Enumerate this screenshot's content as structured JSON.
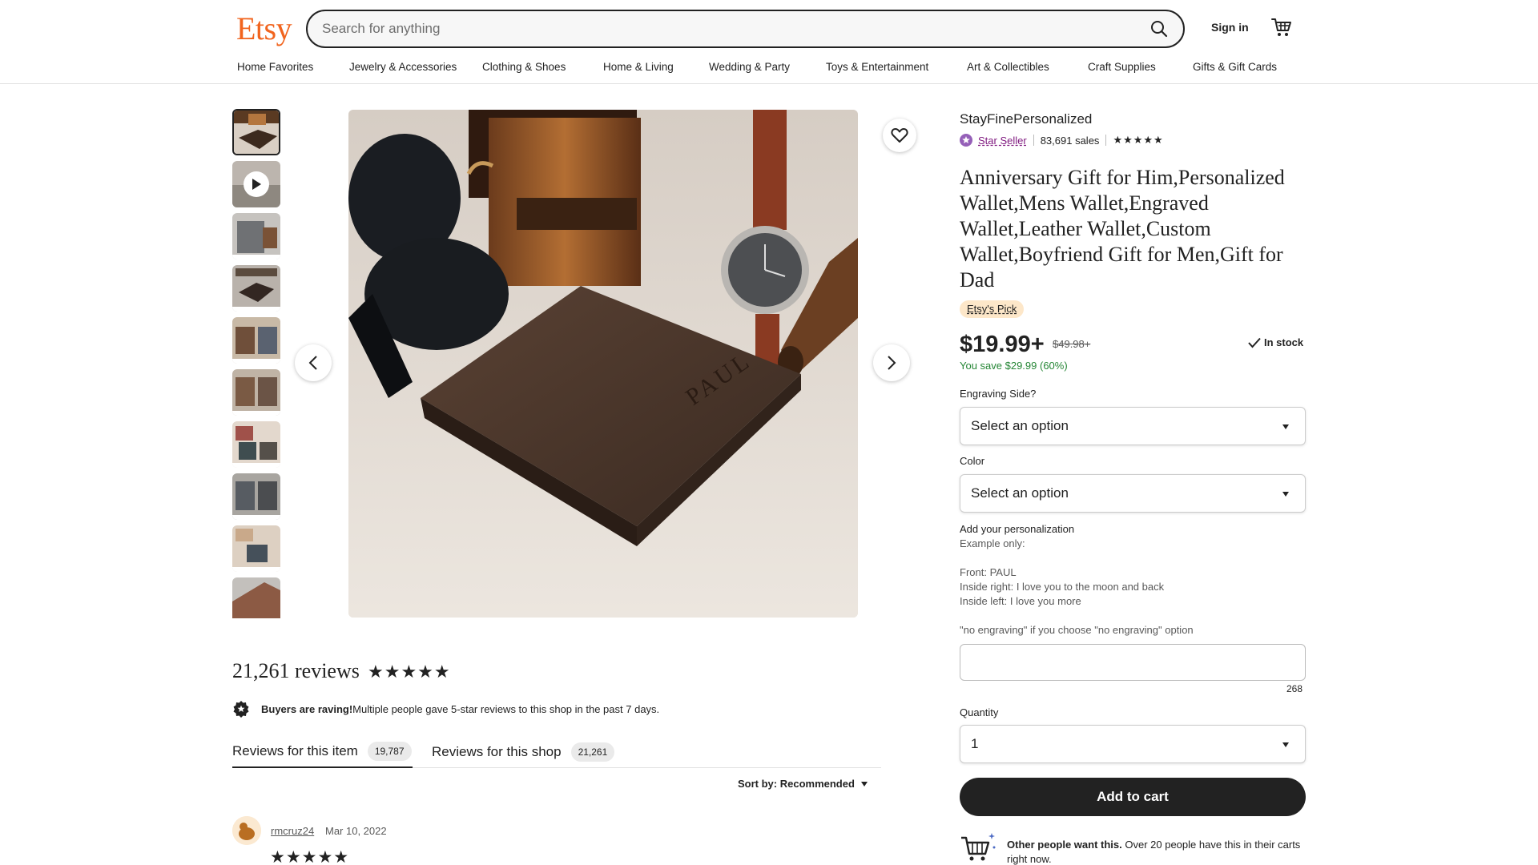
{
  "header": {
    "logo": "Etsy",
    "search_placeholder": "Search for anything",
    "signin_label": "Sign in",
    "categories": [
      "Home Favorites",
      "Jewelry & Accessories",
      "Clothing & Shoes",
      "Home & Living",
      "Wedding & Party",
      "Toys & Entertainment",
      "Art & Collectibles",
      "Craft Supplies",
      "Gifts & Gift Cards"
    ]
  },
  "gallery": {
    "main_image_engraving": "PAUL",
    "thumbnail_count": 10
  },
  "listing": {
    "shop_name": "StayFinePersonalized",
    "star_seller_label": "Star Seller",
    "sales": "83,691 sales",
    "shop_rating_stars": "★★★★★",
    "title": "Anniversary Gift for Him,Personalized Wallet,Mens Wallet,Engraved Wallet,Leather Wallet,Custom Wallet,Boyfriend Gift for Men,Gift for Dad",
    "badge": "Etsy's Pick",
    "price": "$19.99+",
    "original_price": "$49.98+",
    "stock": "In stock",
    "savings": "You save $29.99 (60%)",
    "engraving_side_label": "Engraving Side?",
    "engraving_side_value": "Select an option",
    "color_label": "Color",
    "color_value": "Select an option",
    "personalization_label": "Add your personalization",
    "example_only": "Example only:",
    "example_front": "Front: PAUL",
    "example_inside_right": "Inside right: I love you to the moon and back",
    "example_inside_left": "Inside left: I love you more",
    "no_engraving_note": "\"no engraving\" if you choose \"no engraving\" option",
    "char_counter": "268",
    "quantity_label": "Quantity",
    "quantity_value": "1",
    "add_to_cart": "Add to cart",
    "other_people_bold": "Other people want this.",
    "other_people_text": " Over 20 people have this in their carts right now."
  },
  "reviews": {
    "heading": "21,261 reviews",
    "stars": "★★★★★",
    "raving_bold": "Buyers are raving!",
    "raving_text": " Multiple people gave 5-star reviews to this shop in the past 7 days.",
    "tabs": [
      {
        "label": "Reviews for this item",
        "count": "19,787"
      },
      {
        "label": "Reviews for this shop",
        "count": "21,261"
      }
    ],
    "sort_label": "Sort by: Recommended",
    "first_review": {
      "reviewer": "rmcruz24",
      "date": "Mar 10, 2022",
      "stars": "★★★★★"
    }
  },
  "colors": {
    "brand": "#f1641e",
    "star_seller": "#7f187f",
    "savings_green": "#258635",
    "button_dark": "#222222",
    "pick_badge": "#fde7c9"
  }
}
